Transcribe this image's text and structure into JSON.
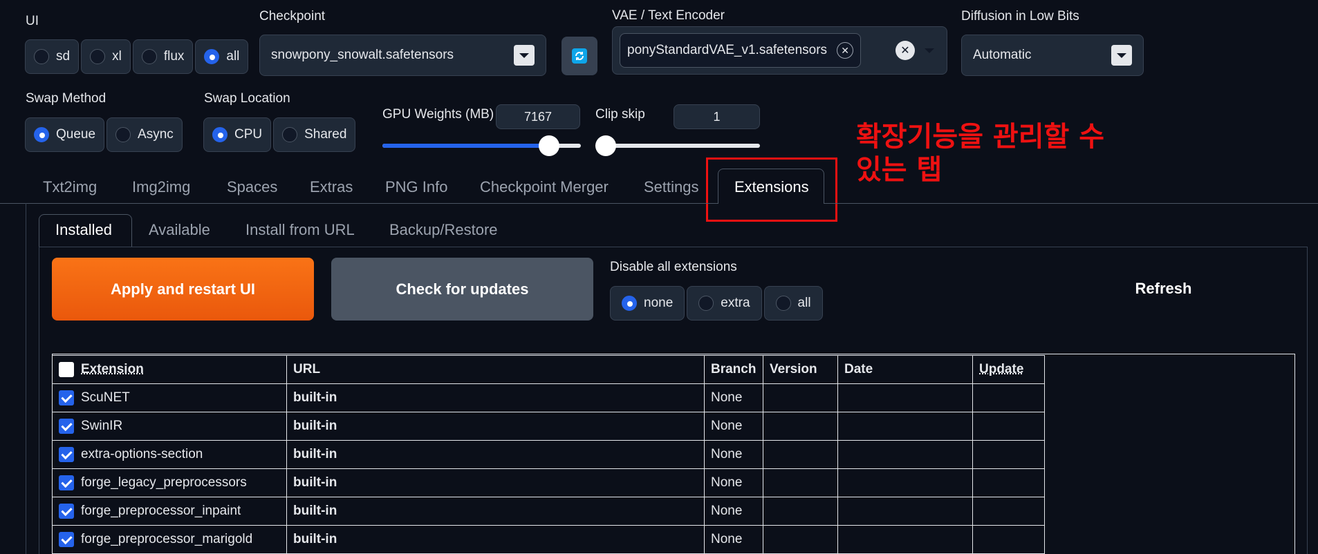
{
  "ui": {
    "label": "UI",
    "options": [
      "sd",
      "xl",
      "flux",
      "all"
    ],
    "selected": "all"
  },
  "checkpoint": {
    "label": "Checkpoint",
    "value": "snowpony_snowalt.safetensors"
  },
  "vae": {
    "label": "VAE / Text Encoder",
    "chip": "ponyStandardVAE_v1.safetensors"
  },
  "diffusion": {
    "label": "Diffusion in Low Bits",
    "value": "Automatic"
  },
  "swap_method": {
    "label": "Swap Method",
    "options": [
      "Queue",
      "Async"
    ],
    "selected": "Queue"
  },
  "swap_location": {
    "label": "Swap Location",
    "options": [
      "CPU",
      "Shared"
    ],
    "selected": "CPU"
  },
  "gpu_weights": {
    "label": "GPU Weights (MB)",
    "value": "7167",
    "fill_fraction": 0.84
  },
  "clip_skip": {
    "label": "Clip skip",
    "value": "1",
    "fill_fraction": 0.0
  },
  "annotation": {
    "line1": "확장기능을 관리할 수",
    "line2": "있는 탭",
    "color": "#ee1111"
  },
  "tabs": [
    "Txt2img",
    "Img2img",
    "Spaces",
    "Extras",
    "PNG Info",
    "Checkpoint Merger",
    "Settings",
    "Extensions"
  ],
  "active_tab": "Extensions",
  "subtabs": [
    "Installed",
    "Available",
    "Install from URL",
    "Backup/Restore"
  ],
  "active_subtab": "Installed",
  "buttons": {
    "apply": "Apply and restart UI",
    "check": "Check for updates",
    "refresh": "Refresh"
  },
  "disable": {
    "label": "Disable all extensions",
    "options": [
      "none",
      "extra",
      "all"
    ],
    "selected": "none"
  },
  "table": {
    "headers": [
      "Extension",
      "URL",
      "Branch",
      "Version",
      "Date",
      "Update"
    ],
    "rows": [
      {
        "name": "ScuNET",
        "url": "built-in",
        "branch": "None"
      },
      {
        "name": "SwinIR",
        "url": "built-in",
        "branch": "None"
      },
      {
        "name": "extra-options-section",
        "url": "built-in",
        "branch": "None"
      },
      {
        "name": "forge_legacy_preprocessors",
        "url": "built-in",
        "branch": "None"
      },
      {
        "name": "forge_preprocessor_inpaint",
        "url": "built-in",
        "branch": "None"
      },
      {
        "name": "forge_preprocessor_marigold",
        "url": "built-in",
        "branch": "None"
      }
    ]
  },
  "colors": {
    "accent": "#2563eb",
    "orange": "#f97316",
    "background": "#0b0f19",
    "panel": "#1f2937"
  }
}
